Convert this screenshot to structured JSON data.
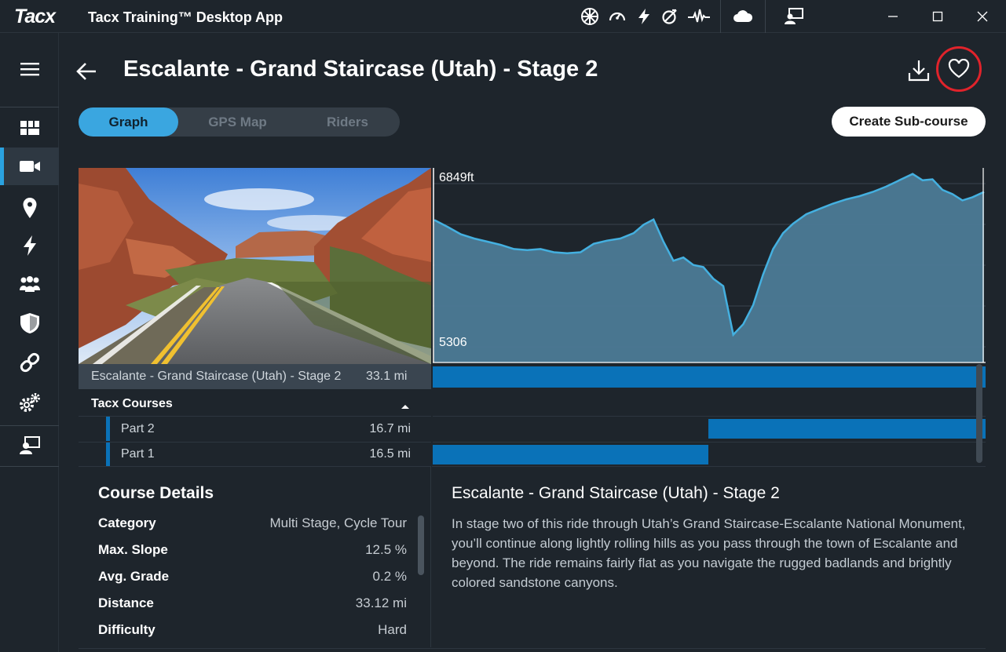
{
  "titlebar": {
    "logo": "Tacx",
    "app_title": "Tacx Training™ Desktop App",
    "icons": [
      "fan-icon",
      "speedometer-icon",
      "power-icon",
      "cadence-icon",
      "heartrate-icon",
      "cloud-icon",
      "remote-display-icon"
    ],
    "window_controls": [
      "minimize-icon",
      "maximize-icon",
      "close-icon"
    ]
  },
  "sidebar": {
    "items": [
      {
        "name": "menu-icon"
      },
      {
        "name": "dashboard-icon"
      },
      {
        "name": "video-icon",
        "active": true
      },
      {
        "name": "location-icon"
      },
      {
        "name": "power-icon"
      },
      {
        "name": "group-icon"
      },
      {
        "name": "shield-icon"
      },
      {
        "name": "link-icon"
      },
      {
        "name": "settings-icon"
      },
      {
        "name": "remote-display-icon"
      }
    ]
  },
  "header": {
    "title": "Escalante - Grand Staircase (Utah) - Stage 2"
  },
  "tabs": [
    {
      "label": "Graph",
      "active": true
    },
    {
      "label": "GPS Map",
      "active": false
    },
    {
      "label": "Riders",
      "active": false
    }
  ],
  "create_button": "Create Sub-course",
  "chart_data": {
    "type": "area",
    "title": "",
    "xlabel": "",
    "ylabel": "",
    "y_max_label": "6849ft",
    "y_min_label": "5306",
    "ylim": [
      5306,
      6849
    ],
    "x_unit": "mi",
    "x_range": [
      0,
      33.1
    ],
    "color": "#44b0e0",
    "series": [
      {
        "x": [
          0,
          0.8,
          1.6,
          2.4,
          3.2,
          4.0,
          4.8,
          5.6,
          6.4,
          7.2,
          8.0,
          8.8,
          9.6,
          10.4,
          11.2,
          12.0,
          12.6,
          13.2,
          13.8,
          14.4,
          15.0,
          15.6,
          16.2,
          16.8,
          17.4,
          18.0,
          18.6,
          19.2,
          19.8,
          20.4,
          21.0,
          21.6,
          22.4,
          23.2,
          24.0,
          24.8,
          25.6,
          26.4,
          27.2,
          28.0,
          28.8,
          29.4,
          30.0,
          30.6,
          31.2,
          31.8,
          32.4,
          33.1
        ],
        "y": [
          6505,
          6440,
          6370,
          6330,
          6300,
          6270,
          6230,
          6220,
          6230,
          6200,
          6190,
          6200,
          6280,
          6310,
          6330,
          6380,
          6460,
          6510,
          6300,
          6120,
          6150,
          6080,
          6060,
          5950,
          5880,
          5420,
          5520,
          5700,
          5990,
          6230,
          6380,
          6470,
          6560,
          6610,
          6660,
          6700,
          6730,
          6770,
          6820,
          6880,
          6940,
          6880,
          6890,
          6790,
          6750,
          6690,
          6720,
          6770
        ]
      }
    ]
  },
  "segments": {
    "main": {
      "name": "Escalante - Grand Staircase (Utah) - Stage 2",
      "distance": "33.1 mi",
      "start": 0,
      "end": 1
    },
    "group_label": "Tacx Courses",
    "parts": [
      {
        "name": "Part 2",
        "distance": "16.7 mi",
        "start": 0.498,
        "end": 1
      },
      {
        "name": "Part 1",
        "distance": "16.5 mi",
        "start": 0,
        "end": 0.498
      }
    ]
  },
  "details": {
    "heading": "Course Details",
    "rows": [
      {
        "key": "Category",
        "value": "Multi Stage, Cycle Tour"
      },
      {
        "key": "Max. Slope",
        "value": "12.5 %"
      },
      {
        "key": "Avg. Grade",
        "value": "0.2 %"
      },
      {
        "key": "Distance",
        "value": "33.12 mi"
      },
      {
        "key": "Difficulty",
        "value": "Hard"
      }
    ]
  },
  "description": {
    "title": "Escalante - Grand Staircase (Utah) - Stage 2",
    "text": "In stage two of this ride through Utah’s Grand Staircase-Escalante National Monument, you’ll continue along lightly rolling hills as you pass through the town of Escalante and beyond. The ride remains fairly flat as you navigate the rugged badlands and brightly colored sandstone canyons."
  }
}
